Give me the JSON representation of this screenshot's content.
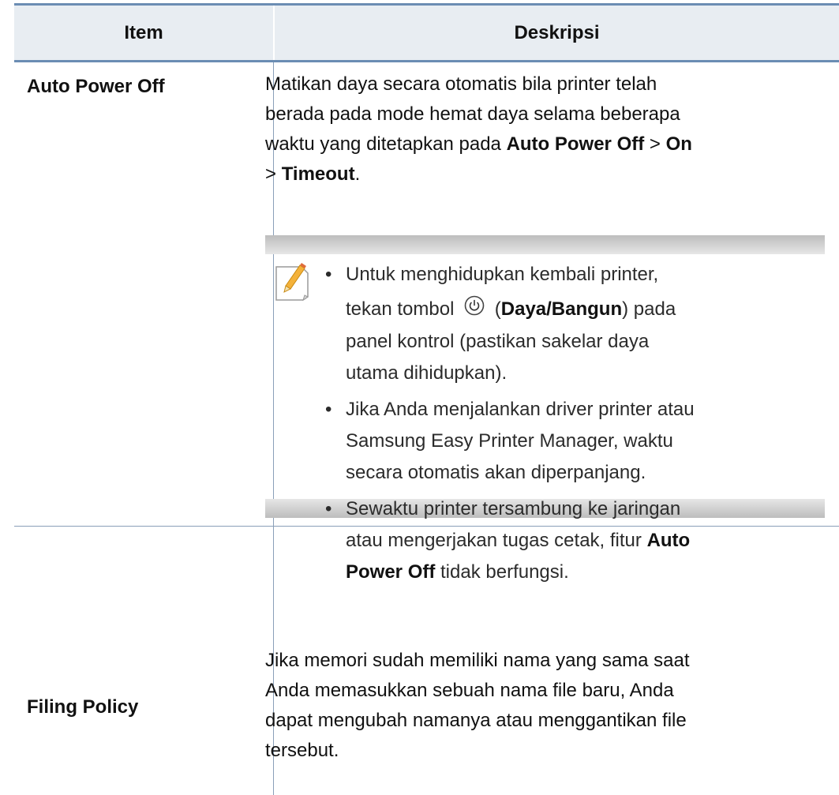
{
  "header": {
    "col_item": "Item",
    "col_desc": "Deskripsi"
  },
  "rows": [
    {
      "item": "Auto Power Off",
      "desc": {
        "p1": "Matikan daya secara otomatis bila printer telah",
        "p2": "berada pada mode hemat daya selama beberapa",
        "p3a": "waktu yang ditetapkan pada ",
        "p3b": "Auto Power Off",
        "p3c": " > ",
        "p3d": "On",
        "p4a": "> ",
        "p4b": "Timeout",
        "p4c": "."
      },
      "note": {
        "b1_l1": "Untuk menghidupkan kembali printer,",
        "b1_l2a": "tekan tombol",
        "b1_l2b": " (",
        "b1_l2c": "Daya/Bangun",
        "b1_l2d": ") pada",
        "b1_l3": "panel kontrol (pastikan sakelar daya",
        "b1_l4": "utama dihidupkan).",
        "b2_l1": "Jika Anda menjalankan driver printer atau",
        "b2_l2": "Samsung Easy Printer Manager, waktu",
        "b2_l3": "secara otomatis akan diperpanjang.",
        "b3_l1": "Sewaktu printer tersambung ke jaringan",
        "b3_l2a": "atau mengerjakan tugas cetak, fitur ",
        "b3_l2b": "Auto",
        "b3_l3a": "Power Off",
        "b3_l3b": " tidak berfungsi."
      }
    },
    {
      "item": "Filing Policy",
      "desc": {
        "l1": "Jika memori sudah memiliki nama yang sama saat",
        "l2": "Anda memasukkan sebuah nama file baru, Anda",
        "l3": "dapat mengubah namanya atau menggantikan file",
        "l4": "tersebut."
      }
    }
  ],
  "icons": {
    "note": "note-pencil-icon",
    "power": "power-button-icon"
  }
}
